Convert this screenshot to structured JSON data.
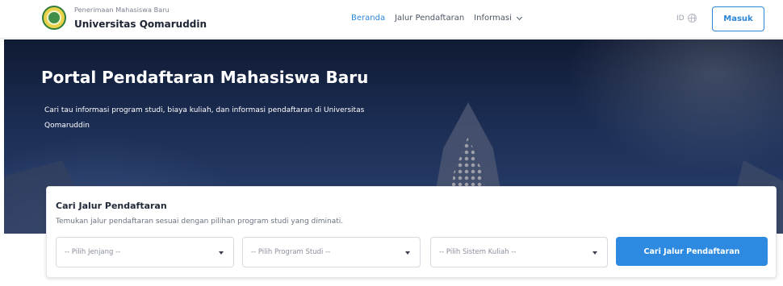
{
  "brand": {
    "subtitle": "Penerimaan Mahasiswa Baru",
    "name": "Universitas Qomaruddin"
  },
  "nav": {
    "items": [
      {
        "label": "Beranda",
        "active": true
      },
      {
        "label": "Jalur Pendaftaran",
        "active": false
      },
      {
        "label": "Informasi",
        "active": false,
        "dropdown": true
      }
    ]
  },
  "language": {
    "label": "ID",
    "icon": "globe-icon"
  },
  "login": {
    "label": "Masuk"
  },
  "hero": {
    "title": "Portal Pendaftaran Mahasiswa Baru",
    "description": "Cari tau informasi program studi, biaya kuliah, dan informasi pendaftaran di Universitas Qomaruddin"
  },
  "search": {
    "title": "Cari Jalur Pendaftaran",
    "description": "Temukan jalur pendaftaran sesuai dengan pilihan program studi yang diminati.",
    "selects": [
      {
        "placeholder": "-- Pilih Jenjang --"
      },
      {
        "placeholder": "-- Pilih Program Studi --"
      },
      {
        "placeholder": "-- Pilih Sistem Kuliah --"
      }
    ],
    "button_label": "Cari Jalur Pendaftaran"
  },
  "colors": {
    "accent": "#2d8ae0",
    "nav_active": "#2c86d8",
    "hero_bg": "#1c2e55"
  }
}
